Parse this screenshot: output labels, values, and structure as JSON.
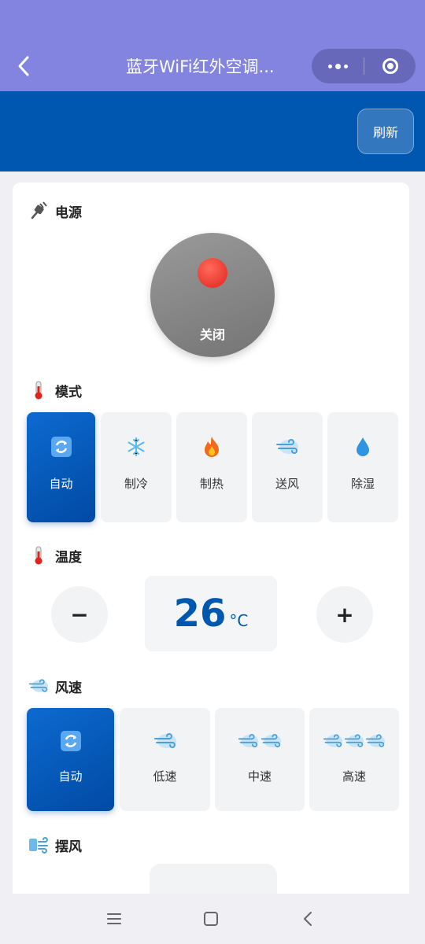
{
  "header": {
    "title": "蓝牙WiFi红外空调...",
    "refresh_label": "刷新"
  },
  "power": {
    "section_label": "电源",
    "state_label": "关闭",
    "state_color": "#e0231c"
  },
  "mode": {
    "section_label": "模式",
    "items": [
      {
        "label": "自动",
        "icon": "auto-cycle-icon",
        "active": true
      },
      {
        "label": "制冷",
        "icon": "snowflake-icon",
        "active": false
      },
      {
        "label": "制热",
        "icon": "fire-icon",
        "active": false
      },
      {
        "label": "送风",
        "icon": "wind-icon",
        "active": false
      },
      {
        "label": "除湿",
        "icon": "droplet-icon",
        "active": false
      }
    ]
  },
  "temperature": {
    "section_label": "温度",
    "value": "26",
    "unit": "°C",
    "decrease_label": "−",
    "increase_label": "+"
  },
  "fan_speed": {
    "section_label": "风速",
    "items": [
      {
        "label": "自动",
        "icon": "auto-cycle-icon",
        "active": true
      },
      {
        "label": "低速",
        "icon": "wind-icon",
        "active": false
      },
      {
        "label": "中速",
        "icon": "wind-icon-x2",
        "active": false
      },
      {
        "label": "高速",
        "icon": "wind-icon-x3",
        "active": false
      }
    ]
  },
  "swing": {
    "section_label": "摆风"
  },
  "colors": {
    "topbar": "#8384e0",
    "brand_blue": "#0057b0",
    "accent_blue": "#0d6ad0"
  }
}
